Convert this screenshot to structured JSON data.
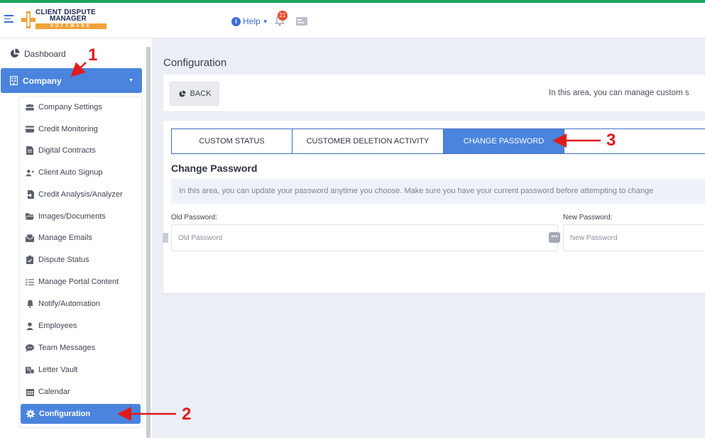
{
  "app": {
    "logo_line1": "CLIENT DISPUTE",
    "logo_line2": "MANAGER",
    "logo_line3": "SOFTWARE"
  },
  "topbar": {
    "help_label": "Help",
    "notification_count": "21",
    "accent_color": "#1aa35a"
  },
  "sidebar": {
    "dashboard_label": "Dashboard",
    "company_label": "Company",
    "items": [
      {
        "label": "Company Settings",
        "icon": "users-icon"
      },
      {
        "label": "Credit Monitoring",
        "icon": "credit-card-icon"
      },
      {
        "label": "Digital Contracts",
        "icon": "document-icon"
      },
      {
        "label": "Client Auto Signup",
        "icon": "user-plus-icon"
      },
      {
        "label": "Credit Analysis/Analyzer",
        "icon": "file-import-icon"
      },
      {
        "label": "Images/Documents",
        "icon": "folder-open-icon"
      },
      {
        "label": "Manage Emails",
        "icon": "mail-box-icon"
      },
      {
        "label": "Dispute Status",
        "icon": "clipboard-check-icon"
      },
      {
        "label": "Manage Portal Content",
        "icon": "list-check-icon"
      },
      {
        "label": "Notify/Automation",
        "icon": "bell-icon"
      },
      {
        "label": "Employees",
        "icon": "user-icon"
      },
      {
        "label": "Team Messages",
        "icon": "chat-icon"
      },
      {
        "label": "Letter Vault",
        "icon": "vault-icon"
      },
      {
        "label": "Calendar",
        "icon": "calendar-icon"
      }
    ],
    "active_item": "Configuration"
  },
  "main": {
    "page_title": "Configuration",
    "back_label": "BACK",
    "info_text": "In this area, you can manage custom s",
    "tabs": [
      "CUSTOM STATUS",
      "CUSTOMER DELETION ACTIVITY",
      "CHANGE PASSWORD"
    ],
    "active_tab": "CHANGE PASSWORD",
    "section_title": "Change Password",
    "section_note": "In this area, you can update your password anytime you choose. Make sure you have your current password before attempting to change",
    "old_password_label": "Old Password:",
    "old_password_placeholder": "Old Password",
    "new_password_label": "New Password:",
    "new_password_placeholder": "New Password"
  },
  "annotations": {
    "marker1": "1",
    "marker2": "2",
    "marker3": "3"
  }
}
